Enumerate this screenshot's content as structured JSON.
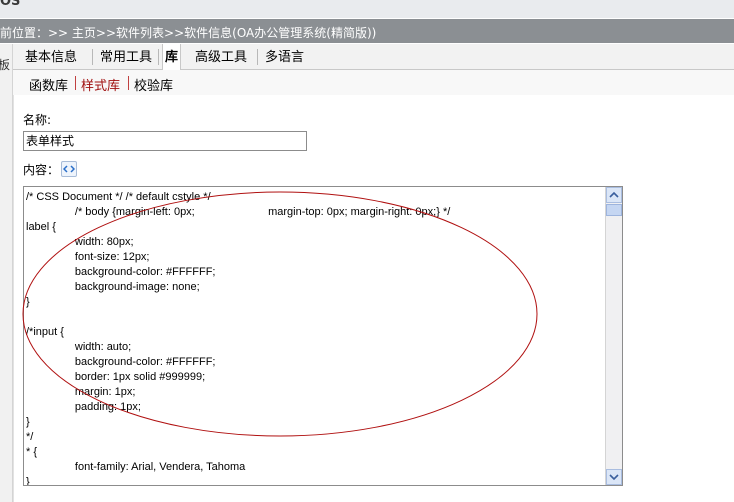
{
  "header": {
    "logo_tail": "OS",
    "breadcrumb": "前位置：>> 主页>>软件列表>>软件信息(OA办公管理系统(精简版))"
  },
  "left_col": {
    "label": "板"
  },
  "tabs": [
    {
      "label": "基本信息"
    },
    {
      "label": "常用工具"
    },
    {
      "label": "库"
    },
    {
      "label": "高级工具"
    },
    {
      "label": "多语言"
    }
  ],
  "active_tab": "库",
  "subtabs": [
    {
      "label": "函数库"
    },
    {
      "label": "样式库"
    },
    {
      "label": "校验库"
    }
  ],
  "active_subtab": "样式库",
  "form": {
    "name_label": "名称:",
    "name_value": "表单样式",
    "content_label": "内容：",
    "content_icon": "html-source-icon"
  },
  "content_lines": [
    "/* CSS Document */ /* default cstyle */",
    "\t\t/* body {margin-left: 0px;\t\t\tmargin-top: 0px; margin-right: 0px;} */",
    "label {",
    "\t\twidth: 80px;",
    "\t\tfont-size: 12px;",
    "\t\tbackground-color: #FFFFFF;",
    "\t\tbackground-image: none;",
    "}",
    "",
    "/*input {",
    "\t\twidth: auto;",
    "\t\tbackground-color: #FFFFFF;",
    "\t\tborder: 1px solid #999999;",
    "\t\tmargin: 1px;",
    "\t\tpadding: 1px;",
    "}",
    "*/",
    "* {",
    "\t\tfont-family: Arial, Vendera, Tahoma",
    "}"
  ],
  "colors": {
    "annotation_ellipse": "#b01010",
    "active_subtab": "#a01010"
  }
}
